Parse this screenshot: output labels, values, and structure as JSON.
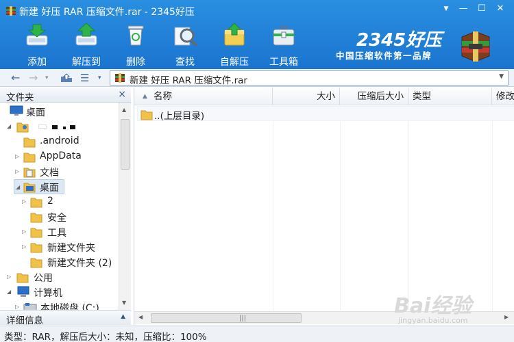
{
  "window": {
    "title": "新建 好压 RAR 压缩文件.rar - 2345好压",
    "controls": [
      "▼",
      "—",
      "☐",
      "✕"
    ]
  },
  "toolbar": {
    "items": [
      {
        "label": "添加",
        "icon": "add-archive-icon"
      },
      {
        "label": "解压到",
        "icon": "extract-to-icon"
      },
      {
        "label": "删除",
        "icon": "delete-recycle-icon"
      },
      {
        "label": "查找",
        "icon": "find-magnifier-icon"
      },
      {
        "label": "自解压",
        "icon": "self-extract-icon"
      },
      {
        "label": "工具箱",
        "icon": "toolbox-icon"
      }
    ]
  },
  "brand": {
    "name": "2345好压",
    "slogan": "中国压缩软件第一品牌"
  },
  "address": {
    "path": "新建 好压 RAR 压缩文件.rar"
  },
  "left_panel": {
    "header": "文件夹",
    "close": "×",
    "footer": "详细信息",
    "tree": [
      {
        "label": "桌面",
        "icon": "desktop-icon"
      },
      {
        "label": "",
        "icon": "user-folder-icon"
      },
      {
        "label": ".android",
        "icon": "folder-icon"
      },
      {
        "label": "AppData",
        "icon": "folder-icon"
      },
      {
        "label": "文档",
        "icon": "documents-icon"
      },
      {
        "label": "桌面",
        "icon": "desktop-icon",
        "selected": true
      },
      {
        "label": "2",
        "icon": "folder-icon"
      },
      {
        "label": "安全",
        "icon": "folder-icon"
      },
      {
        "label": "工具",
        "icon": "folder-icon"
      },
      {
        "label": "新建文件夹",
        "icon": "folder-icon"
      },
      {
        "label": "新建文件夹 (2)",
        "icon": "folder-icon"
      },
      {
        "label": "公用",
        "icon": "folder-icon"
      },
      {
        "label": "计算机",
        "icon": "computer-icon"
      },
      {
        "label": "本地磁盘 (C:)",
        "icon": "drive-icon"
      }
    ]
  },
  "file_list": {
    "columns": [
      "名称",
      "大小",
      "压缩后大小",
      "类型",
      "修改"
    ],
    "sort_indicator": "▲",
    "rows": [
      {
        "name": "..(上层目录)",
        "icon": "folder-icon"
      }
    ]
  },
  "status": {
    "text": "类型：RAR，解压后大小：未知，压缩比：100%"
  },
  "watermark": {
    "text1": "Bai经验",
    "text2": "jingyan.baidu.com"
  },
  "colors": {
    "toolbar_blue": "#1f80d6",
    "folder_yellow": "#f0c24a",
    "selection": "#dde8f5"
  }
}
